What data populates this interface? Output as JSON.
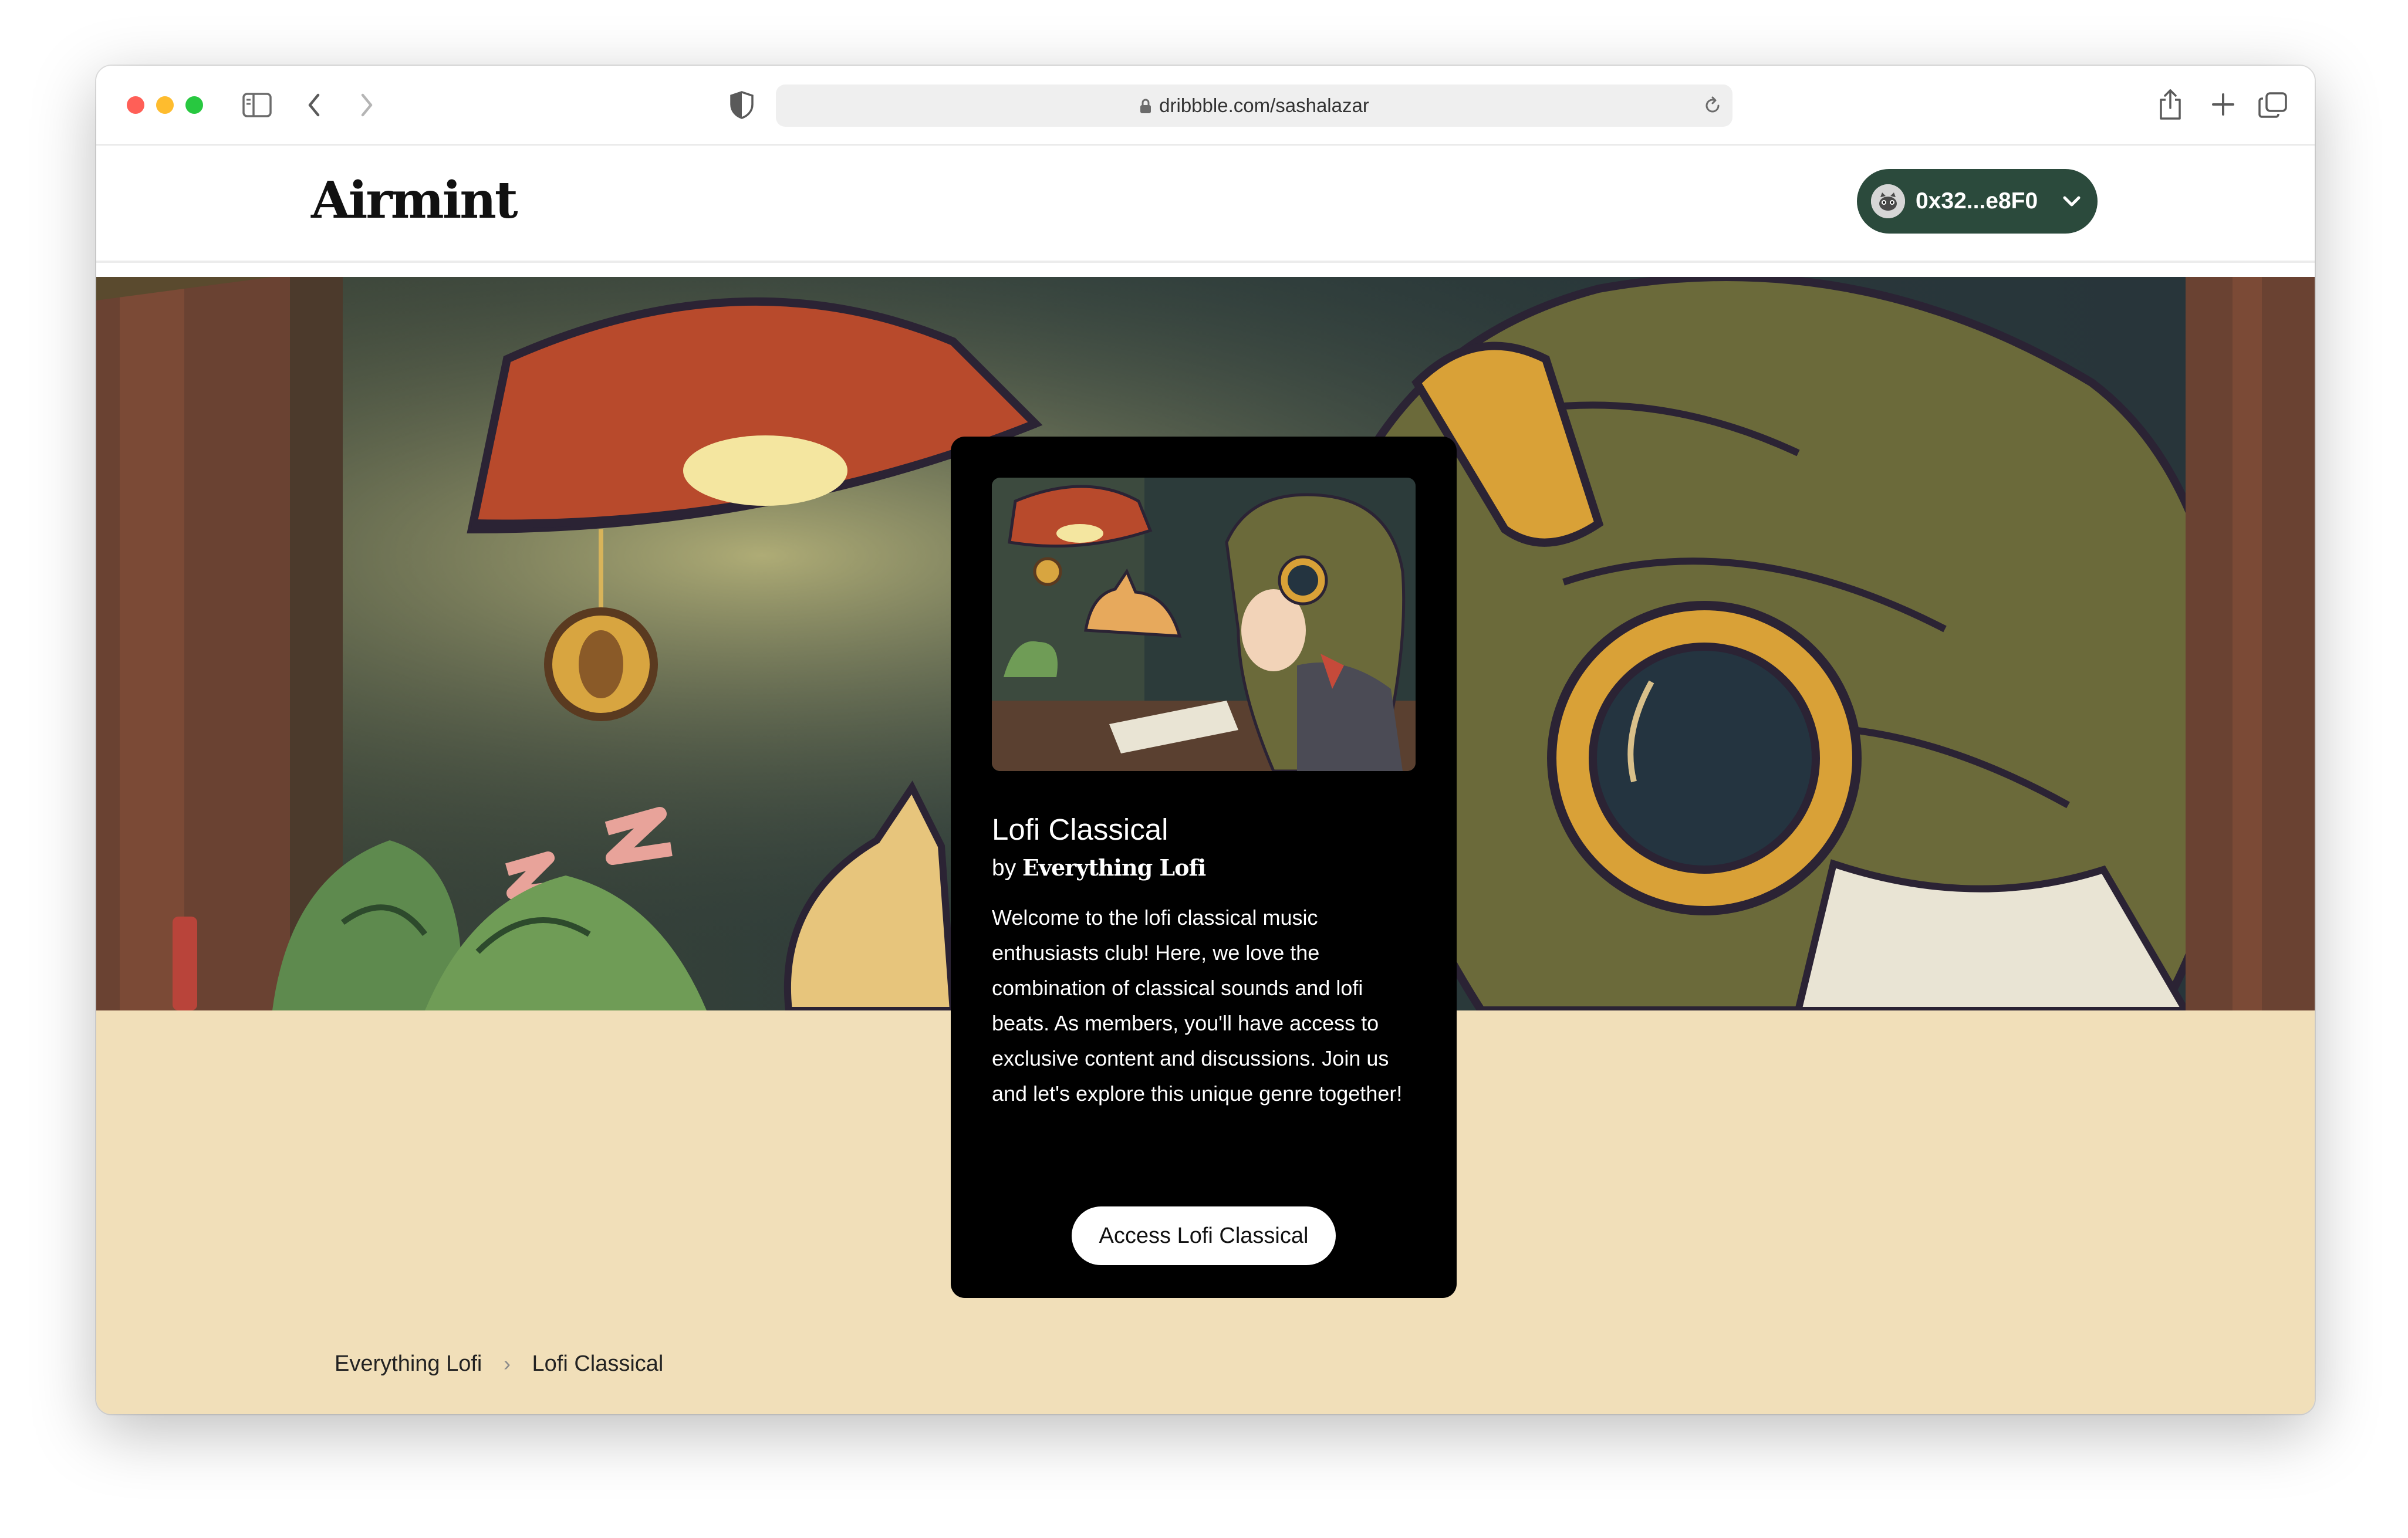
{
  "browser": {
    "url": "dribbble.com/sashalazar",
    "traffic_lights": {
      "close": "#ff5f57",
      "minimize": "#febc2e",
      "zoom": "#28c840"
    }
  },
  "header": {
    "logo": "Airmint",
    "wallet": {
      "address": "0x32...e8F0",
      "color": "#2b4a3c"
    }
  },
  "card": {
    "title": "Lofi Classical",
    "by_prefix": "by",
    "creator": "Everything Lofi",
    "description": "Welcome to the lofi classical music enthusiasts club! Here, we love the combination of classical sounds and lofi beats. As members, you'll have access to exclusive content and discussions. Join us and let's explore this unique genre together!",
    "button_label": "Access Lofi Classical"
  },
  "breadcrumb": {
    "items": [
      "Everything Lofi",
      "Lofi Classical"
    ],
    "separator": "›"
  },
  "colors": {
    "page_background": "#f1dfb9",
    "card_background": "#000000"
  }
}
